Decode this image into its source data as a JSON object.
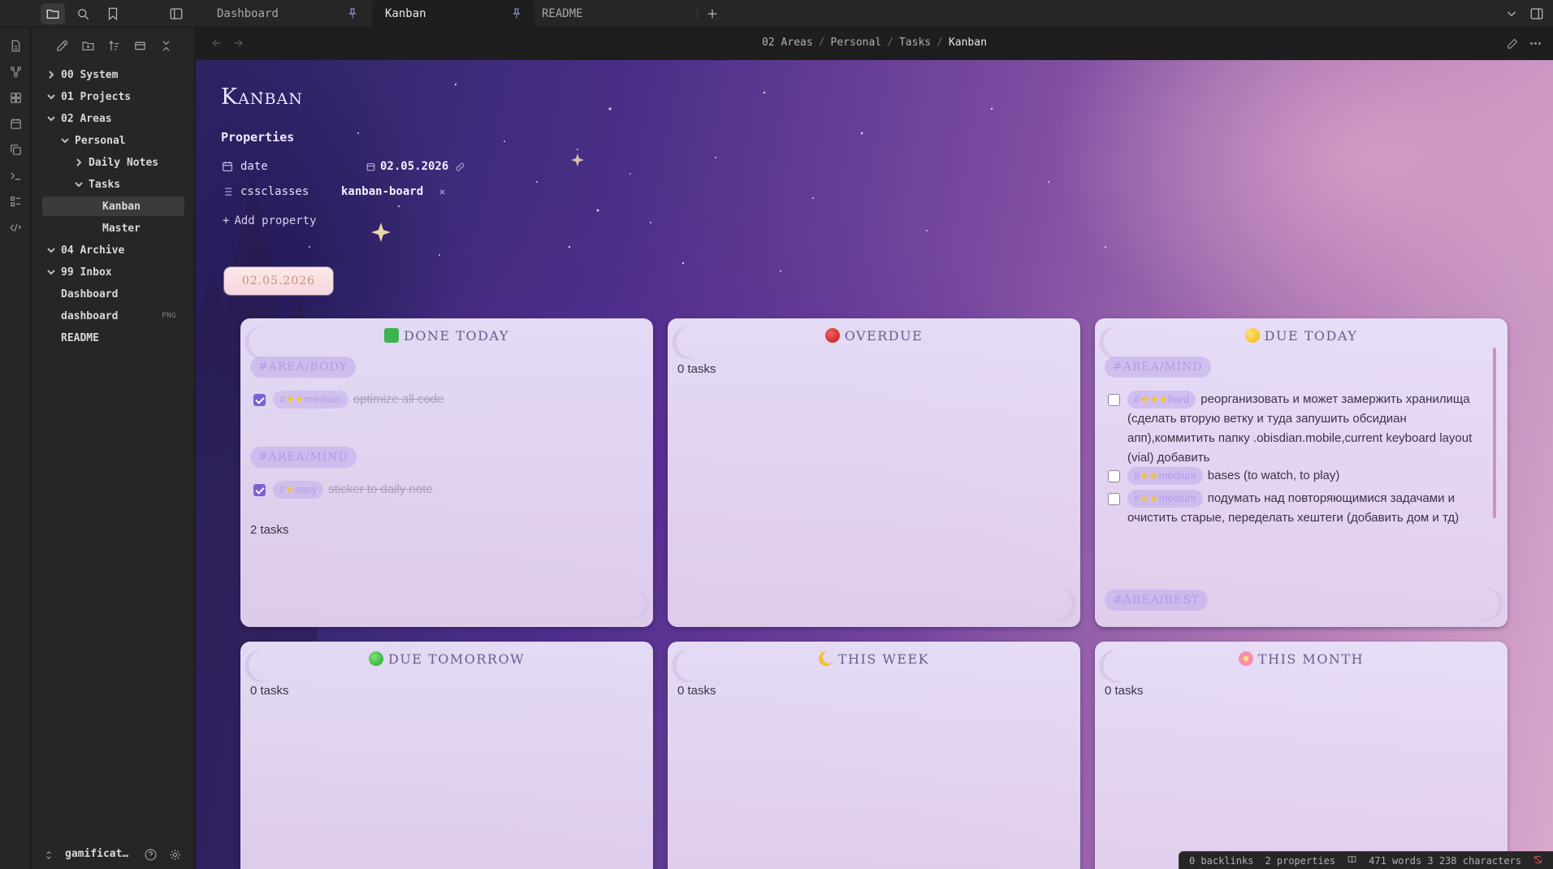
{
  "tabs": [
    {
      "label": "Dashboard",
      "pinned": true
    },
    {
      "label": "Kanban",
      "pinned": true,
      "active": true
    },
    {
      "label": "README",
      "pinned": false
    }
  ],
  "breadcrumb": {
    "parts": [
      "02 Areas",
      "Personal",
      "Tasks"
    ],
    "current": "Kanban"
  },
  "tree": [
    {
      "label": "00 System",
      "chevron": "right"
    },
    {
      "label": "01 Projects",
      "chevron": "down"
    },
    {
      "label": "02 Areas",
      "chevron": "down"
    },
    {
      "label": "Personal",
      "chevron": "down"
    },
    {
      "label": "Daily Notes",
      "chevron": "right"
    },
    {
      "label": "Tasks",
      "chevron": "down"
    },
    {
      "label": "Kanban",
      "active": true
    },
    {
      "label": "Master"
    },
    {
      "label": "04 Archive",
      "chevron": "down"
    },
    {
      "label": "99 Inbox",
      "chevron": "down"
    },
    {
      "label": "Dashboard"
    },
    {
      "label": "dashboard",
      "ext": "PNG"
    },
    {
      "label": "README"
    }
  ],
  "vault": {
    "name": "gamificat…"
  },
  "note": {
    "title": "Kanban",
    "properties_heading": "Properties",
    "properties": [
      {
        "key": "date",
        "value": "02.05.2026"
      },
      {
        "key": "cssclasses",
        "value": "kanban-board"
      }
    ],
    "add_property": "Add property",
    "date_pill": "02.05.2026"
  },
  "board": {
    "done_today": {
      "title": "Done today",
      "groups": [
        {
          "tag": "#AREA/BODY",
          "tasks": [
            {
              "difficulty": "medium",
              "stars": 2,
              "text": "optimize all code",
              "done": true
            }
          ]
        },
        {
          "tag": "#AREA/MIND",
          "tasks": [
            {
              "difficulty": "easy",
              "stars": 1,
              "text": "sticker to daily note",
              "done": true
            }
          ]
        }
      ],
      "count": "2 tasks"
    },
    "overdue": {
      "title": "Overdue",
      "count": "0 tasks"
    },
    "due_today": {
      "title": "Due today",
      "groups": [
        {
          "tag": "#AREA/MIND",
          "tasks": [
            {
              "difficulty": "hard",
              "stars": 3,
              "text": "реорганизовать и может замержить хранилища (сделать вторую ветку и туда запушить обсидиан апп),коммитить папку .obisdian.mobile,current keyboard layout (vial) добавить",
              "done": false
            },
            {
              "difficulty": "medium",
              "stars": 2,
              "text": "bases (to watch, to play)",
              "done": false
            },
            {
              "difficulty": "medium",
              "stars": 2,
              "text": "подумать над повторяющимися задачами и очистить старые, переделать хештеги (добавить дом и тд)",
              "done": false
            }
          ]
        },
        {
          "tag": "#AREA/REST",
          "tasks": []
        }
      ]
    },
    "due_tomorrow": {
      "title": "Due tomorrow",
      "count": "0 tasks"
    },
    "this_week": {
      "title": "This week",
      "count": "0 tasks"
    },
    "this_month": {
      "title": "This month",
      "count": "0 tasks"
    }
  },
  "statusbar": {
    "backlinks": "0 backlinks",
    "properties": "2 properties",
    "words": "471 words",
    "characters": "3 238 characters"
  },
  "colors": {
    "accent": "#7b61d6",
    "tag_text": "#b39be6",
    "card_title": "#6b5b8c",
    "star": "#f0c330"
  }
}
